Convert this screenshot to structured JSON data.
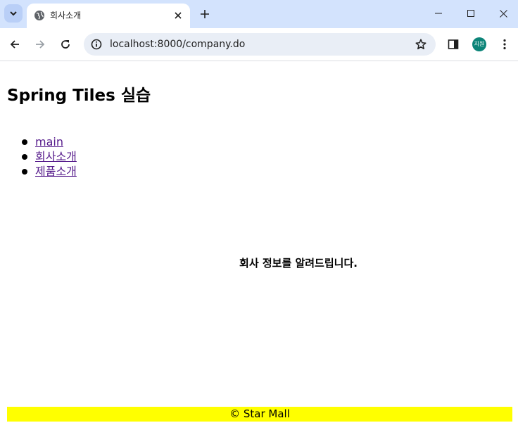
{
  "browser": {
    "tab_title": "회사소개",
    "url": "localhost:8000/company.do",
    "profile_label": "지원"
  },
  "page": {
    "title": "Spring Tiles 실습",
    "menu": [
      {
        "label": "main"
      },
      {
        "label": "회사소개"
      },
      {
        "label": "제품소개"
      }
    ],
    "content": "회사 정보를 알려드립니다.",
    "footer": "© Star Mall"
  },
  "colors": {
    "tabbar": "#d3e3fd",
    "link_visited": "#551a8b",
    "footer_bg": "#ffff00",
    "avatar": "#0b8478"
  }
}
